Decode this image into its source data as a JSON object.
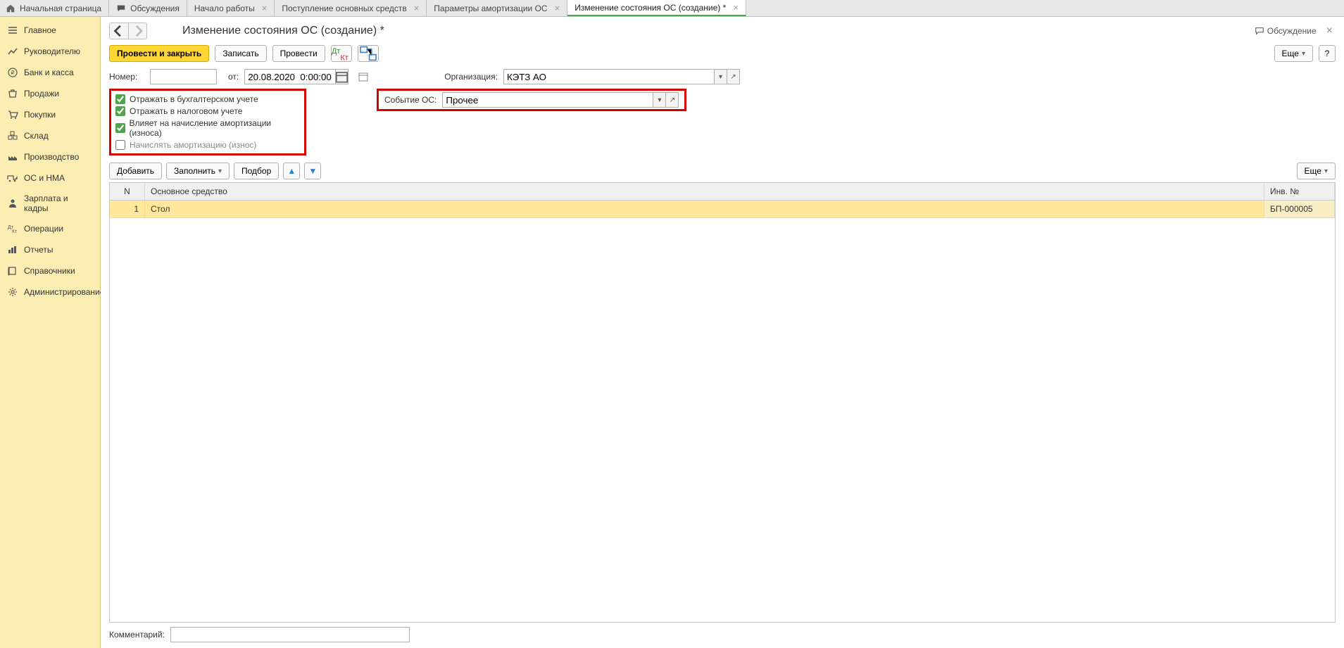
{
  "tabs": {
    "home": "Начальная страница",
    "discussions": "Обсуждения",
    "start": "Начало работы",
    "receipt": "Поступление основных средств",
    "params": "Параметры амортизации ОС",
    "change": "Изменение состояния ОС (создание) *"
  },
  "sidebar": {
    "main": "Главное",
    "manager": "Руководителю",
    "bank": "Банк и касса",
    "sales": "Продажи",
    "purchases": "Покупки",
    "warehouse": "Склад",
    "production": "Производство",
    "fixed": "ОС и НМА",
    "salary": "Зарплата и кадры",
    "operations": "Операции",
    "reports": "Отчеты",
    "refs": "Справочники",
    "admin": "Администрирование"
  },
  "header": {
    "title": "Изменение состояния ОС (создание) *",
    "discussion": "Обсуждение"
  },
  "toolbar": {
    "post_close": "Провести и закрыть",
    "save": "Записать",
    "post": "Провести",
    "more": "Еще",
    "help": "?"
  },
  "form": {
    "number_label": "Номер:",
    "number_value": "",
    "from_label": "от:",
    "date_value": "20.08.2020  0:00:00",
    "org_label": "Организация:",
    "org_value": "КЭТЗ АО",
    "event_label": "Событие ОС:",
    "event_value": "Прочее",
    "chk_bu": "Отражать в бухгалтерском учете",
    "chk_nu": "Отражать в налоговом учете",
    "chk_affect": "Влияет на начисление амортизации (износа)",
    "chk_calc": "Начислять амортизацию (износ)"
  },
  "table_toolbar": {
    "add": "Добавить",
    "fill": "Заполнить",
    "select": "Подбор",
    "more": "Еще"
  },
  "table": {
    "col_n": "N",
    "col_asset": "Основное средство",
    "col_inv": "Инв. №",
    "rows": [
      {
        "n": "1",
        "asset": "Стол",
        "inv": "БП-000005"
      }
    ]
  },
  "comment": {
    "label": "Комментарий:",
    "value": ""
  }
}
